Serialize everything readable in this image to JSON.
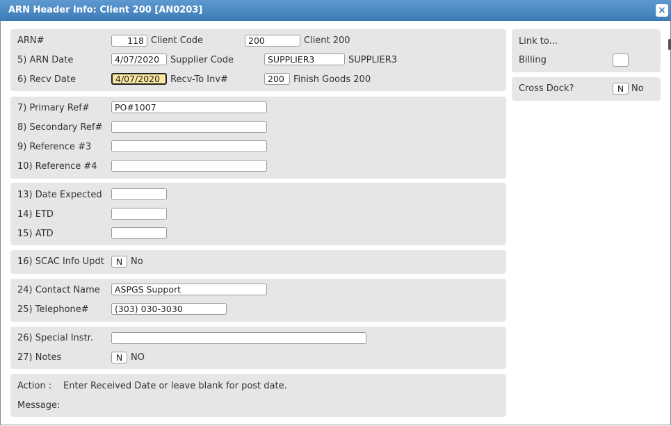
{
  "window": {
    "title": "ARN Header Info: Client 200 [AN0203]",
    "close_glyph": "×"
  },
  "header": {
    "arn_label": "ARN#",
    "arn_value": "118",
    "client_code_label": "Client Code",
    "client_code_value": "200",
    "client_name": "Client 200",
    "arn_date_label": "5) ARN Date",
    "arn_date_value": "4/07/2020",
    "supplier_code_label": "Supplier Code",
    "supplier_code_value": "SUPPLIER3",
    "supplier_name": "SUPPLIER3",
    "recv_date_label": "6) Recv Date",
    "recv_date_value": "4/07/2020",
    "recv_to_inv_label": "Recv-To Inv#",
    "recv_to_inv_value": "200",
    "recv_to_inv_name": "Finish Goods 200"
  },
  "references": {
    "primary_label": "7) Primary Ref#",
    "primary_value": "PO#1007",
    "secondary_label": "8) Secondary Ref#",
    "secondary_value": "",
    "ref3_label": "9) Reference #3",
    "ref3_value": "",
    "ref4_label": "10) Reference #4",
    "ref4_value": ""
  },
  "dates": {
    "expected_label": "13) Date Expected",
    "expected_value": "",
    "etd_label": "14) ETD",
    "etd_value": "",
    "atd_label": "15) ATD",
    "atd_value": ""
  },
  "scac": {
    "label": "16) SCAC Info Updt",
    "value": "N",
    "desc": "No"
  },
  "contact": {
    "name_label": "24) Contact Name",
    "name_value": "ASPGS Support",
    "phone_label": "25) Telephone#",
    "phone_value": "(303) 030-3030"
  },
  "instructions": {
    "special_label": "26) Special Instr.",
    "special_value": "",
    "notes_label": "27) Notes",
    "notes_value": "N",
    "notes_desc": "NO"
  },
  "status": {
    "action_label": "Action :",
    "action_text": "Enter Received Date or leave blank for post date.",
    "message_label": "Message:",
    "message_text": ""
  },
  "sidebar": {
    "link_to_label": "Link to...",
    "billing_label": "Billing",
    "billing_value": "",
    "cross_dock_label": "Cross Dock?",
    "cross_dock_value": "N",
    "cross_dock_desc": "No"
  }
}
